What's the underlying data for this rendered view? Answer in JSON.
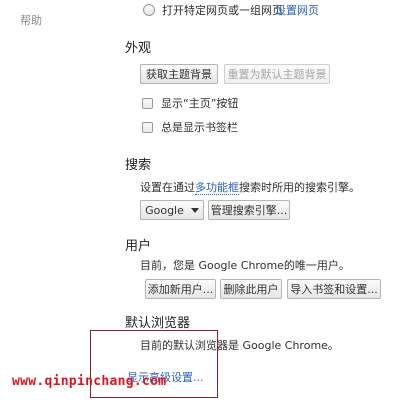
{
  "sidebar": {
    "help_label": "帮助"
  },
  "startup": {
    "open_pages_label": "打开特定网页或一组网页",
    "set_pages_link": "设置网页"
  },
  "appearance": {
    "title": "外观",
    "get_themes_button": "获取主题背景",
    "reset_theme_button": "重置为默认主题背景",
    "show_home_button_label": "显示“主页”按钮",
    "show_bookmarks_bar_label": "总是显示书签栏"
  },
  "search": {
    "title": "搜索",
    "desc_prefix": "设置在通过",
    "omnibox_link": "多功能框",
    "desc_suffix": "搜索时所用的搜索引擎。",
    "engine_selected": "Google",
    "manage_button": "管理搜索引擎..."
  },
  "users": {
    "title": "用户",
    "desc": "目前，您是 Google Chrome的唯一用户。",
    "add_user_button": "添加新用户...",
    "delete_user_button": "删除此用户",
    "import_button": "导入书签和设置..."
  },
  "default_browser": {
    "title": "默认浏览器",
    "desc": "目前的默认浏览器是 Google Chrome。",
    "advanced_link": "显示高级设置..."
  },
  "watermark": {
    "text": "www.qinpinchang.com"
  },
  "colors": {
    "link": "#2b5fc4",
    "annotation_box": "#8b1e2b",
    "watermark": "#e0141e"
  }
}
